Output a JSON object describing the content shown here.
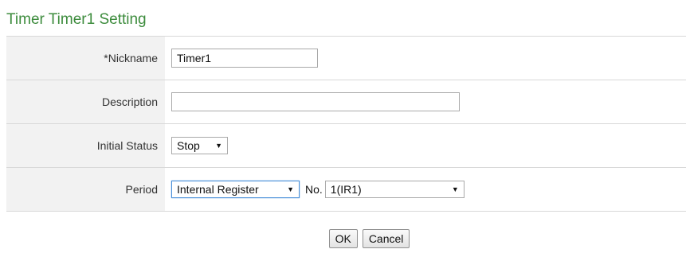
{
  "page": {
    "title": "Timer Timer1 Setting"
  },
  "form": {
    "nickname": {
      "label": "*Nickname",
      "value": "Timer1"
    },
    "description": {
      "label": "Description",
      "value": ""
    },
    "initial_status": {
      "label": "Initial Status",
      "selected": "Stop"
    },
    "period": {
      "label": "Period",
      "source_selected": "Internal Register",
      "no_label": "No.",
      "number_selected": "1(IR1)"
    }
  },
  "buttons": {
    "ok": "OK",
    "cancel": "Cancel"
  },
  "icons": {
    "dropdown_arrow": "▼"
  },
  "colors": {
    "title": "#3d8c3d",
    "label_bg": "#f2f2f2",
    "focus_border": "#4a90d9"
  }
}
